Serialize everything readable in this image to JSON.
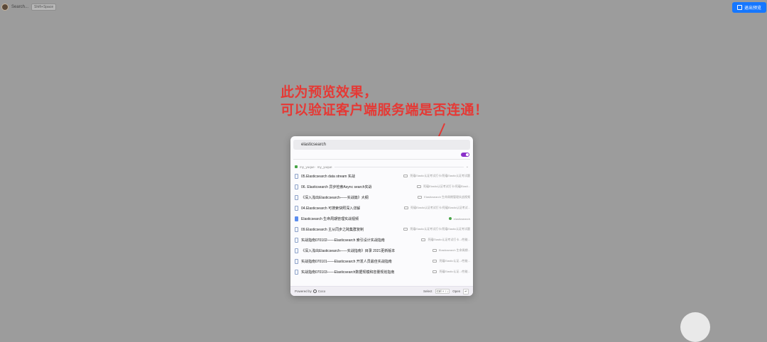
{
  "topbar": {
    "app_title": "Search...",
    "shortcut": "Shift+Space",
    "exit_preview_label": "退出预览"
  },
  "annotation": {
    "line1": "此为预览效果，",
    "line2": "可以验证客户端服务端是否连通！"
  },
  "search": {
    "query": "elasticsearch"
  },
  "source": {
    "label": "my_yuque · my_yuque",
    "more": "⌄"
  },
  "results": [
    {
      "title": "05.Elasticsearch data stream 实战",
      "path": "死磕Elastic认证考试打卡/死磕Elastic认证考试题",
      "icon": "doc"
    },
    {
      "title": "06. Elasticsearch 异步检索Async search实战",
      "path": "死磕Elastic认证考试打卡/死磕Elasti...",
      "icon": "doc"
    },
    {
      "title": "《深入浅出Elasticsearch——实战篇》大纲",
      "path": "Elasticsearch 生命周期管理实战视频",
      "icon": "doc"
    },
    {
      "title": "04.Elasticsearch 可搜索快照深入详解",
      "path": "死磕Elastic认证考试打卡/死磕Elastic认证考试...",
      "icon": "doc"
    },
    {
      "title": "Elasticsearch 生命周期管理实战视频",
      "path": "elasticsearch",
      "icon": "doc-blue"
    },
    {
      "title": "09.Elasticsearch 主从同步之跨集群复制",
      "path": "死磕Elastic认证考试打卡/死磕Elastic认证考试题",
      "icon": "doc"
    },
    {
      "title": "实战指南070102——Elasticsearch 索引设计实战指南",
      "path": "死磕Elastic认证考试打卡.../性能...",
      "icon": "doc"
    },
    {
      "title": "《深入浅出Elasticsearch——实战指南》目录 2021更新版本",
      "path": "Elasticsearch 生命周期...",
      "icon": "doc"
    },
    {
      "title": "实战指南070101——Elasticsearch 开发人员最佳实战指南",
      "path": "死磕Elastic认证.../性能...",
      "icon": "doc"
    },
    {
      "title": "实战指南070103——Elasticsearch数据规模和容量规划指南",
      "path": "死磕Elastic认证.../性能...",
      "icon": "doc"
    }
  ],
  "footer": {
    "powered_by": "Powered by",
    "brand": "Coco",
    "select_label": "Select",
    "select_keys": "Ctrl + ↑↓",
    "open_label": "Open",
    "open_key": "↵"
  },
  "colors": {
    "accent": "#1677ff",
    "annotation": "#e53935",
    "toggle": "#8b2fc9"
  }
}
